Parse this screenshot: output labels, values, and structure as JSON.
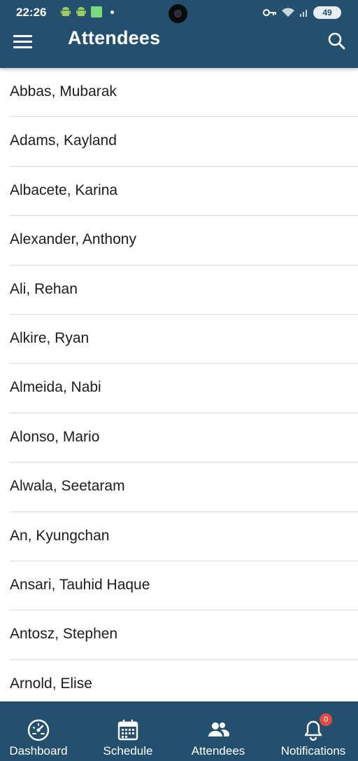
{
  "status_bar": {
    "time": "22:26",
    "battery": "49"
  },
  "header": {
    "title": "Attendees",
    "menu_icon": "hamburger-menu-icon",
    "search_icon": "search-icon",
    "background_color": "#23506f"
  },
  "attendees": [
    "Abbas, Mubarak",
    "Adams, Kayland",
    "Albacete, Karina",
    "Alexander, Anthony",
    "Ali, Rehan",
    "Alkire, Ryan",
    "Almeida, Nabi",
    "Alonso, Mario",
    "Alwala, Seetaram",
    "An, Kyungchan",
    "Ansari, Tauhid Haque",
    "Antosz, Stephen",
    "Arnold, Elise"
  ],
  "bottom_nav": {
    "items": [
      {
        "label": "Dashboard",
        "icon": "gauge-icon"
      },
      {
        "label": "Schedule",
        "icon": "calendar-icon"
      },
      {
        "label": "Attendees",
        "icon": "people-icon"
      },
      {
        "label": "Notifications",
        "icon": "bell-icon",
        "badge": "0"
      }
    ]
  }
}
